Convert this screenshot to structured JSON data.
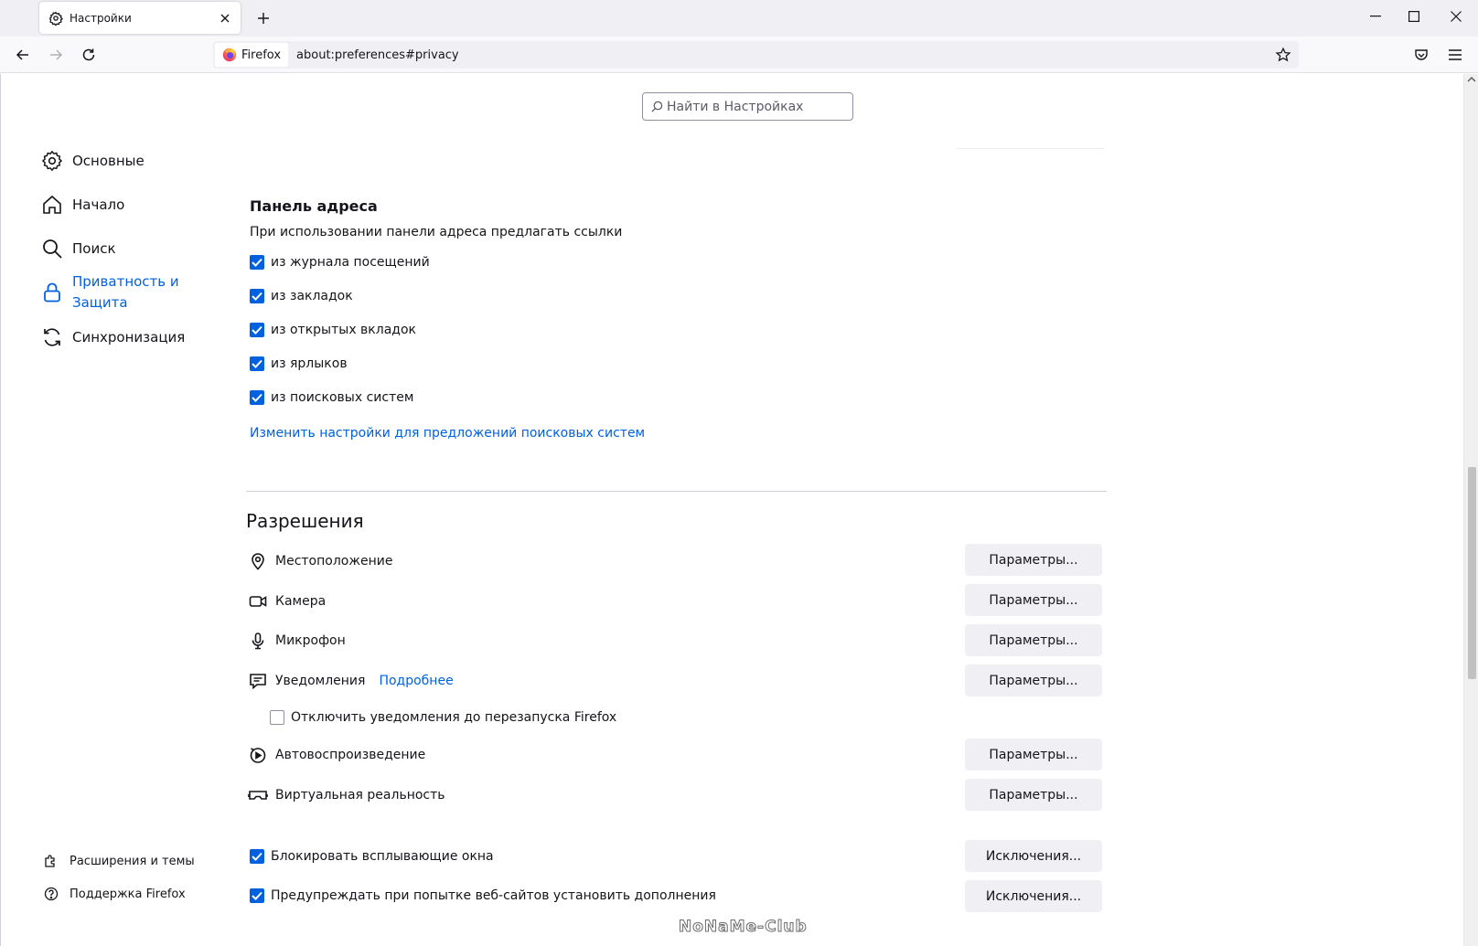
{
  "browser": {
    "tab_title": "Настройки",
    "identity_label": "Firefox",
    "url": "about:preferences#privacy"
  },
  "search": {
    "placeholder": "Найти в Настройках"
  },
  "sidebar": {
    "categories": [
      {
        "label": "Основные",
        "icon": "gear-icon"
      },
      {
        "label": "Начало",
        "icon": "home-icon"
      },
      {
        "label": "Поиск",
        "icon": "search-icon"
      },
      {
        "label_line1": "Приватность и",
        "label_line2": "Защита",
        "icon": "lock-icon",
        "active": true
      },
      {
        "label": "Синхронизация",
        "icon": "sync-icon"
      }
    ],
    "footer": [
      {
        "label": "Расширения и темы",
        "icon": "puzzle-icon"
      },
      {
        "label": "Поддержка Firefox",
        "icon": "help-icon"
      }
    ]
  },
  "address_bar_section": {
    "title": "Панель адреса",
    "description": "При использовании панели адреса предлагать ссылки",
    "options": [
      {
        "label": "из журнала посещений",
        "checked": true
      },
      {
        "label": "из закладок",
        "checked": true
      },
      {
        "label": "из открытых вкладок",
        "checked": true
      },
      {
        "label": "из ярлыков",
        "checked": true
      },
      {
        "label": "из поисковых систем",
        "checked": true
      }
    ],
    "change_link": "Изменить настройки для предложений поисковых систем"
  },
  "permissions": {
    "title": "Разрешения",
    "items": [
      {
        "label": "Местоположение",
        "icon": "location-pin-icon",
        "button": "Параметры..."
      },
      {
        "label": "Камера",
        "icon": "camera-icon",
        "button": "Параметры..."
      },
      {
        "label": "Микрофон",
        "icon": "microphone-icon",
        "button": "Параметры..."
      },
      {
        "label": "Уведомления",
        "icon": "notification-icon",
        "link": "Подробнее",
        "button": "Параметры..."
      },
      {
        "label": "Автовоспроизведение",
        "icon": "autoplay-icon",
        "button": "Параметры..."
      },
      {
        "label": "Виртуальная реальность",
        "icon": "vr-headset-icon",
        "button": "Параметры..."
      }
    ],
    "pause_notifications": {
      "label": "Отключить уведомления до перезапуска Firefox",
      "checked": false
    },
    "block_popups": {
      "label": "Блокировать всплывающие окна",
      "checked": true,
      "button": "Исключения..."
    },
    "warn_addons": {
      "label": "Предупреждать при попытке веб-сайтов установить дополнения",
      "checked": true,
      "button": "Исключения..."
    }
  },
  "watermark": "NoNaMe-Club",
  "colors": {
    "accent": "#0061e0",
    "button_bg": "#f0f0f4",
    "text": "#15141a"
  }
}
